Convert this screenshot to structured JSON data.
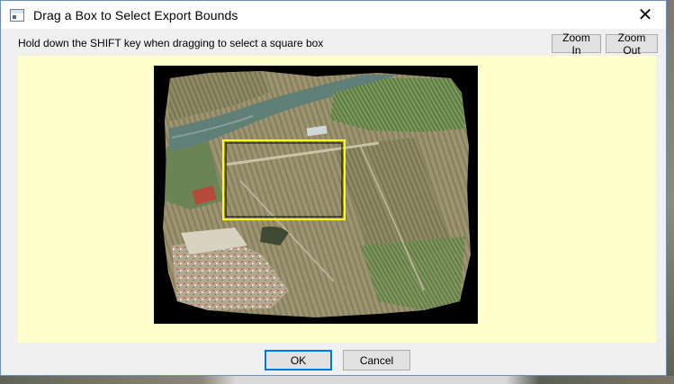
{
  "window": {
    "title": "Drag a Box to Select Export Bounds",
    "close_glyph": "✕"
  },
  "toolbar": {
    "hint": "Hold down the SHIFT key when dragging to select a square box",
    "zoom_in_label": "Zoom In",
    "zoom_out_label": "Zoom Out"
  },
  "map": {
    "selection_color": "#ffff00",
    "canvas_background": "#ffffcc"
  },
  "footer": {
    "ok_label": "OK",
    "cancel_label": "Cancel"
  },
  "icons": {
    "app": "app-window-icon",
    "close": "close-icon"
  }
}
